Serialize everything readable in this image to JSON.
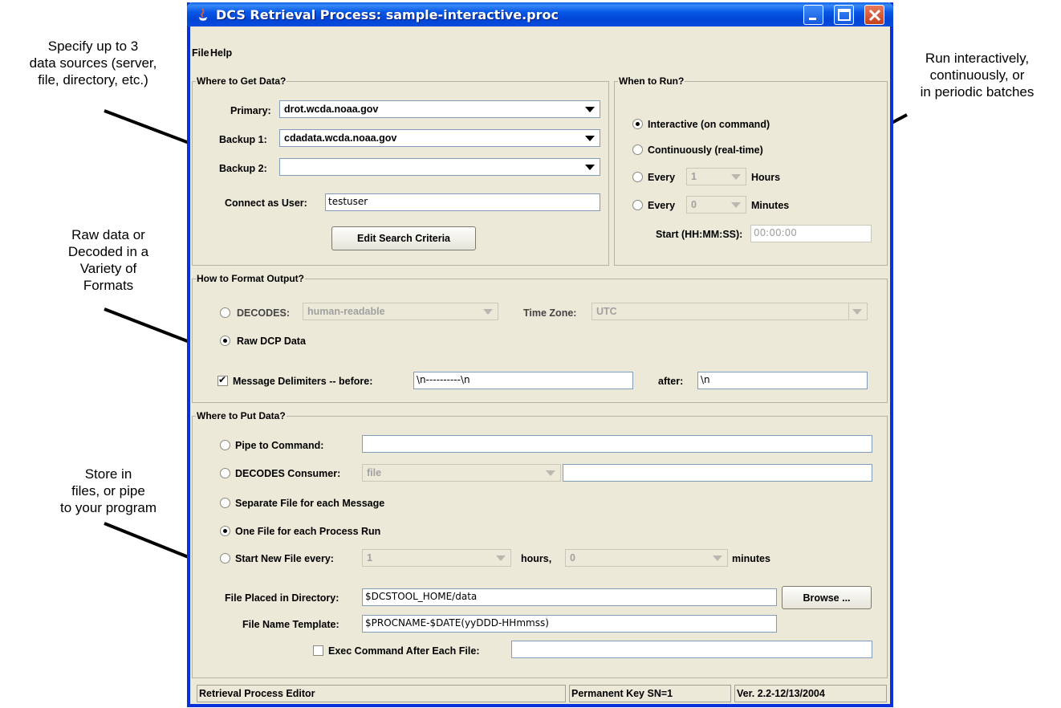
{
  "annotations": {
    "sources": [
      "Specify up to 3",
      "data sources (server,",
      "file, directory, etc.)"
    ],
    "run": [
      "Run interactively,",
      "continuously, or",
      "in periodic batches"
    ],
    "format": [
      "Raw data or",
      "Decoded in a",
      "Variety of",
      "Formats"
    ],
    "store": [
      "Store in",
      "files, or pipe",
      "to your program"
    ]
  },
  "window": {
    "title": "DCS Retrieval Process: sample-interactive.proc"
  },
  "menu": {
    "file": "File",
    "help": "Help"
  },
  "where_to_get": {
    "title": "Where to Get Data?",
    "primary_label": "Primary:",
    "primary_value": "drot.wcda.noaa.gov",
    "backup1_label": "Backup 1:",
    "backup1_value": "cdadata.wcda.noaa.gov",
    "backup2_label": "Backup 2:",
    "backup2_value": "",
    "user_label": "Connect as User:",
    "user_value": "testuser",
    "edit_button": "Edit Search Criteria"
  },
  "when_to_run": {
    "title": "When to Run?",
    "interactive": "Interactive (on command)",
    "continuous": "Continuously (real-time)",
    "every1": "Every",
    "hours_value": "1",
    "hours_label": "Hours",
    "every2": "Every",
    "minutes_value": "0",
    "minutes_label": "Minutes",
    "start_label": "Start (HH:MM:SS):",
    "start_value": "00:00:00",
    "selected": "interactive"
  },
  "format_output": {
    "title": "How to Format Output?",
    "decodes_label": "DECODES:",
    "decodes_value": "human-readable",
    "tz_label": "Time Zone:",
    "tz_value": "UTC",
    "raw_label": "Raw DCP Data",
    "delim_label": "Message Delimiters -- before:",
    "delim_before": "\\n----------\\n",
    "after_label": "after:",
    "delim_after": "\\n",
    "selected": "raw",
    "delim_checked": true
  },
  "put_data": {
    "title": "Where to Put Data?",
    "pipe_label": "Pipe to Command:",
    "pipe_value": "",
    "consumer_label": "DECODES Consumer:",
    "consumer_value": "file",
    "consumer_arg": "",
    "separate_label": "Separate File for each Message",
    "onefile_label": "One File for each Process Run",
    "newfile_label": "Start New File every:",
    "newfile_hours": "1",
    "hours_label": "hours,",
    "newfile_minutes": "0",
    "minutes_label": "minutes",
    "dir_label": "File Placed in Directory:",
    "dir_value": "$DCSTOOL_HOME/data",
    "browse_button": "Browse ...",
    "template_label": "File Name Template:",
    "template_value": "$PROCNAME-$DATE(yyDDD-HHmmss)",
    "exec_label": "Exec Command After Each File:",
    "exec_value": "",
    "selected": "onefile",
    "exec_checked": false
  },
  "status": {
    "left": "Retrieval Process Editor",
    "mid": "Permanent Key SN=1",
    "right": "Ver. 2.2-12/13/2004"
  }
}
